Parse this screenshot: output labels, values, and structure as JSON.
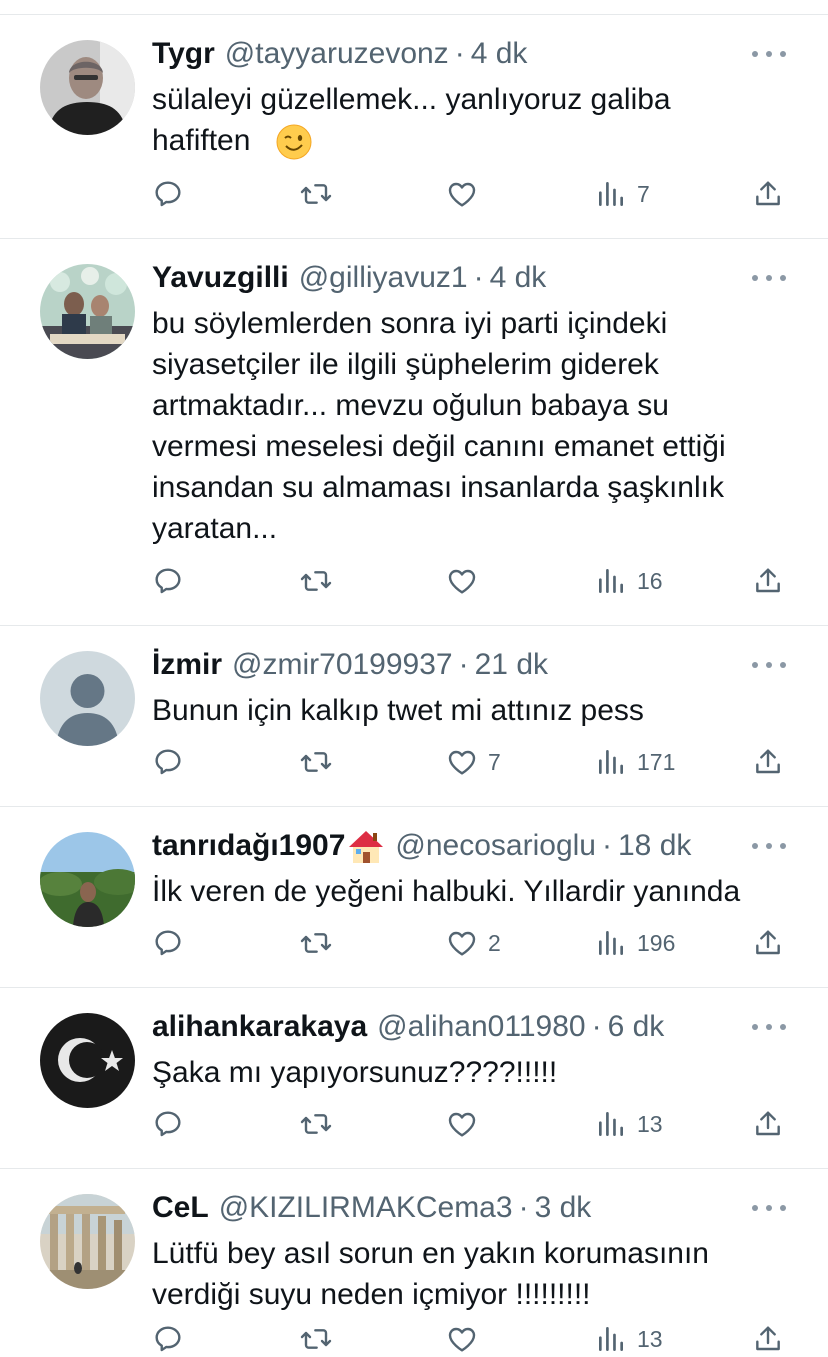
{
  "replies": [
    {
      "name": "Tygr",
      "handle": "@tayyaruzevonz",
      "separator": "·",
      "time": "4 dk",
      "text": "sülaleyi güzellemek... yanlıyoruz galiba\nhafiften",
      "has_emoji": true,
      "emoji_icon": "wink-emoji-icon",
      "likes": "",
      "views": "7"
    },
    {
      "name": "Yavuzgilli",
      "handle": "@gilliyavuz1",
      "separator": "·",
      "time": "4 dk",
      "text": "bu söylemlerden sonra iyi parti içindeki\nsiyasetçiler ile ilgili şüphelerim giderek\nartmaktadır... mevzu oğulun babaya su\nvermesi meselesi değil canını emanet ettiği\ninsandan su almaması insanlarda şaşkınlık\nyaratan...",
      "likes": "",
      "views": "16"
    },
    {
      "name": "İzmir",
      "handle": "@zmir70199937",
      "separator": "·",
      "time": "21 dk",
      "text": "Bunun için kalkıp twet mi attınız pess",
      "likes": "7",
      "views": "171"
    },
    {
      "name": "tanrıdağı1907",
      "handle": "@necosarioglu",
      "separator": "·",
      "time": "18 dk",
      "text": "İlk veren de yeğeni halbuki. Yıllardir yanında",
      "has_emoji": true,
      "emoji_icon": "house-emoji-icon",
      "likes": "2",
      "views": "196"
    },
    {
      "name": "alihankarakaya",
      "handle": "@alihan011980",
      "separator": "·",
      "time": "6 dk",
      "text": "Şaka mı yapıyorsunuz????!!!!!",
      "likes": "",
      "views": "13"
    },
    {
      "name": "CeL",
      "handle": "@KIZILIRMAKCema3",
      "separator": "·",
      "time": "3 dk",
      "text": "Lütfü bey asıl sorun en yakın korumasının\nverdiği suyu neden içmiyor !!!!!!!!!",
      "likes": "",
      "views": "13"
    }
  ],
  "colors": {
    "text": "#0f1419",
    "secondary": "#536471",
    "divider": "#e6e9eb"
  }
}
